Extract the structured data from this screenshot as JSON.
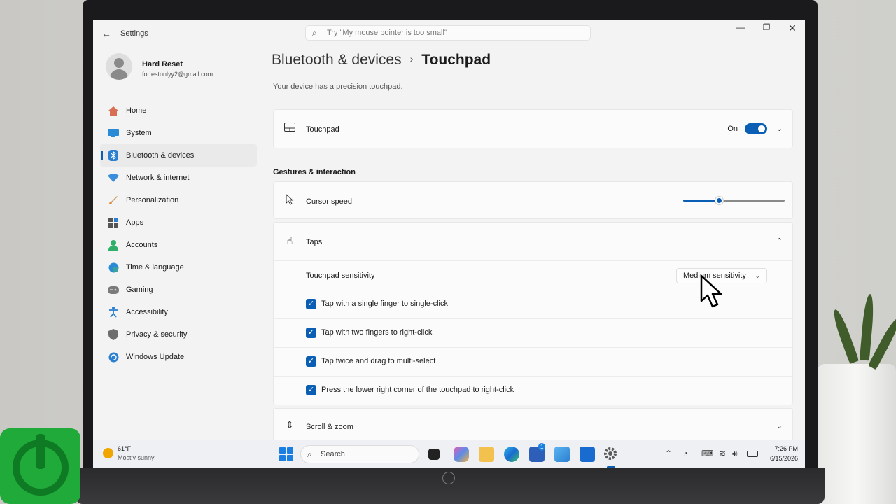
{
  "window": {
    "app_title": "Settings",
    "search_placeholder": "Try \"My mouse pointer is too small\""
  },
  "profile": {
    "name": "Hard Reset",
    "email": "fortestonlyy2@gmail.com"
  },
  "sidebar": {
    "items": [
      {
        "label": "Home",
        "icon": "home-icon",
        "active": false
      },
      {
        "label": "System",
        "icon": "system-icon",
        "active": false
      },
      {
        "label": "Bluetooth & devices",
        "icon": "bluetooth-icon",
        "active": true
      },
      {
        "label": "Network & internet",
        "icon": "wifi-icon",
        "active": false
      },
      {
        "label": "Personalization",
        "icon": "brush-icon",
        "active": false
      },
      {
        "label": "Apps",
        "icon": "apps-icon",
        "active": false
      },
      {
        "label": "Accounts",
        "icon": "accounts-icon",
        "active": false
      },
      {
        "label": "Time & language",
        "icon": "globe-icon",
        "active": false
      },
      {
        "label": "Gaming",
        "icon": "gamepad-icon",
        "active": false
      },
      {
        "label": "Accessibility",
        "icon": "accessibility-icon",
        "active": false
      },
      {
        "label": "Privacy & security",
        "icon": "shield-icon",
        "active": false
      },
      {
        "label": "Windows Update",
        "icon": "update-icon",
        "active": false
      }
    ]
  },
  "main": {
    "breadcrumb_parent": "Bluetooth & devices",
    "breadcrumb_separator": "›",
    "breadcrumb_current": "Touchpad",
    "subtitle": "Your device has a precision touchpad.",
    "touchpad_card": {
      "label": "Touchpad",
      "state_label": "On",
      "enabled": true
    },
    "gestures_header": "Gestures & interaction",
    "cursor_speed": {
      "label": "Cursor speed",
      "value_fraction": 0.35
    },
    "taps": {
      "label": "Taps",
      "expanded": true,
      "sensitivity_label": "Touchpad sensitivity",
      "sensitivity_value": "Medium sensitivity",
      "options": [
        {
          "label": "Tap with a single finger to single-click",
          "checked": true
        },
        {
          "label": "Tap with two fingers to right-click",
          "checked": true
        },
        {
          "label": "Tap twice and drag to multi-select",
          "checked": true
        },
        {
          "label": "Press the lower right corner of the touchpad to right-click",
          "checked": true
        }
      ]
    },
    "scroll_zoom": {
      "label": "Scroll & zoom",
      "expanded": false
    }
  },
  "taskbar": {
    "weather_temp": "61°F",
    "weather_desc": "Mostly sunny",
    "search_label": "Search",
    "time": "7:26 PM",
    "date": "6/15/2026",
    "teams_badge": "1"
  },
  "colors": {
    "accent": "#0a5fb4"
  }
}
